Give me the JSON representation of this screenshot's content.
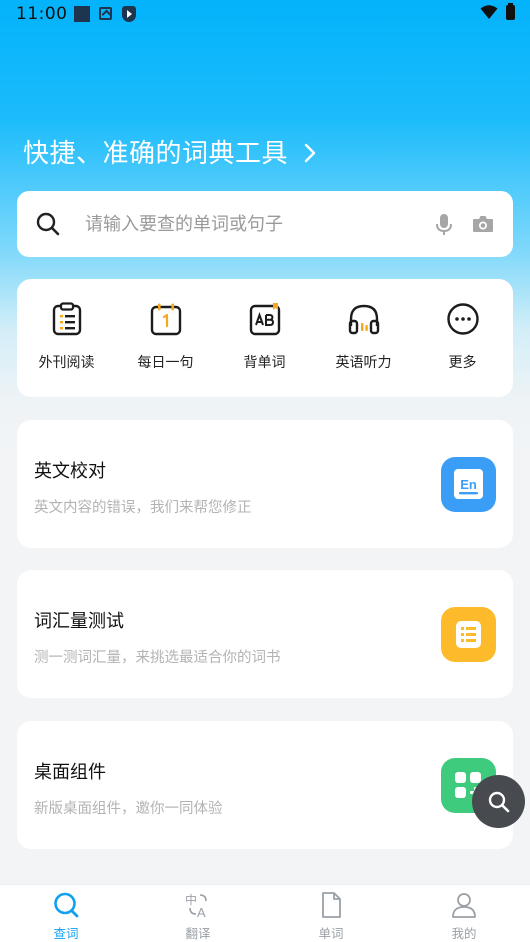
{
  "status_bar": {
    "time": "11:00"
  },
  "header": {
    "headline": "快捷、准确的词典工具"
  },
  "search": {
    "placeholder": "请输入要查的单词或句子"
  },
  "quick_actions": [
    {
      "label": "外刊阅读",
      "icon": "clipboard-list-icon"
    },
    {
      "label": "每日一句",
      "icon": "calendar-icon"
    },
    {
      "label": "背单词",
      "icon": "ab-card-icon"
    },
    {
      "label": "英语听力",
      "icon": "headphones-icon"
    },
    {
      "label": "更多",
      "icon": "more-dots-icon"
    }
  ],
  "feature_cards": [
    {
      "title": "英文校对",
      "subtitle": "英文内容的错误，我们来帮您修正",
      "icon": "en-document-icon",
      "color": "#3b9ef6"
    },
    {
      "title": "词汇量测试",
      "subtitle": "测一测词汇量，来挑选最适合你的词书",
      "icon": "list-icon",
      "color": "#fdbb2b"
    },
    {
      "title": "桌面组件",
      "subtitle": "新版桌面组件，邀你一同体验",
      "icon": "widgets-icon",
      "color": "#3ecb7d"
    }
  ],
  "bottom_nav": [
    {
      "label": "查词",
      "icon": "search-icon",
      "active": true
    },
    {
      "label": "翻译",
      "icon": "translate-icon",
      "active": false
    },
    {
      "label": "单词",
      "icon": "document-icon",
      "active": false
    },
    {
      "label": "我的",
      "icon": "user-icon",
      "active": false
    }
  ],
  "colors": {
    "accent": "#10a0f0",
    "header_blue": "#03b3fb",
    "inactive": "#9aa0a6",
    "fab": "#474a4e"
  }
}
